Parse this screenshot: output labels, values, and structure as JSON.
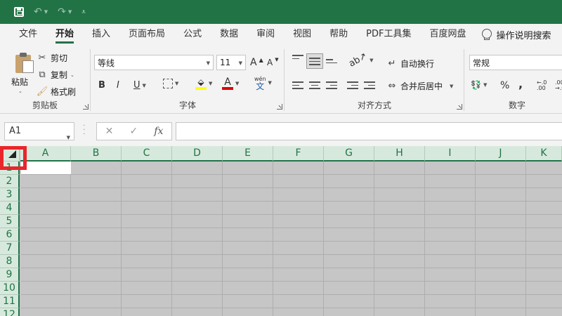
{
  "quick_access": {
    "save_icon": "save-icon",
    "undo_icon": "undo-icon",
    "redo_icon": "redo-icon",
    "customize_icon": "customize-icon"
  },
  "menu": {
    "tabs": [
      "文件",
      "开始",
      "插入",
      "页面布局",
      "公式",
      "数据",
      "审阅",
      "视图",
      "帮助",
      "PDF工具集",
      "百度网盘"
    ],
    "active_index": 1,
    "search_label": "操作说明搜索"
  },
  "ribbon": {
    "clipboard": {
      "paste_label": "粘贴",
      "cut_label": "剪切",
      "copy_label": "复制",
      "format_painter_label": "格式刷",
      "group_label": "剪贴板"
    },
    "font": {
      "font_name": "等线",
      "font_size": "11",
      "grow_label": "A",
      "shrink_label": "A",
      "bold": "B",
      "italic": "I",
      "underline": "U",
      "font_color_letter": "A",
      "phonetic_label": "wén",
      "phonetic_char": "文",
      "group_label": "字体"
    },
    "alignment": {
      "wrap_label": "自动换行",
      "merge_label": "合并后居中",
      "group_label": "对齐方式"
    },
    "number": {
      "format": "常规",
      "percent": "%",
      "comma": ",",
      "inc_decimal": "←.0 .00",
      "dec_decimal": ".00 →.0",
      "group_label": "数字"
    }
  },
  "formula_bar": {
    "name_box": "A1",
    "cancel": "✕",
    "enter": "✓",
    "fx": "fx",
    "value": ""
  },
  "sheet": {
    "columns": [
      "A",
      "B",
      "C",
      "D",
      "E",
      "F",
      "G",
      "H",
      "I",
      "J",
      "K"
    ],
    "rows": [
      "1",
      "2",
      "3",
      "4",
      "5",
      "6",
      "7",
      "8",
      "9",
      "10",
      "11",
      "12"
    ]
  },
  "colors": {
    "accent": "#217346",
    "header_bg": "#d7e9dd",
    "highlight": "#e8262c",
    "selection_bg": "#c6c6c6"
  }
}
